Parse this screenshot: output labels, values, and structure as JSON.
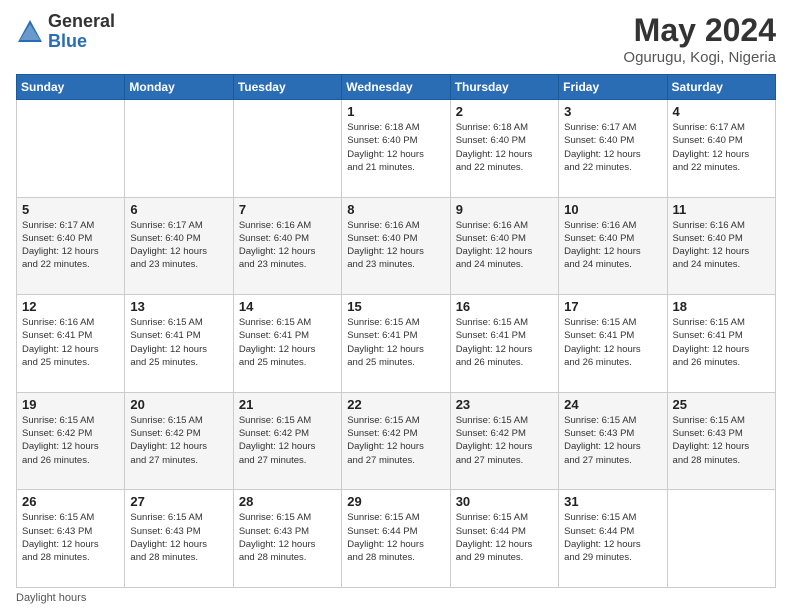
{
  "logo": {
    "general": "General",
    "blue": "Blue"
  },
  "title": "May 2024",
  "subtitle": "Ogurugu, Kogi, Nigeria",
  "days_header": [
    "Sunday",
    "Monday",
    "Tuesday",
    "Wednesday",
    "Thursday",
    "Friday",
    "Saturday"
  ],
  "weeks": [
    [
      {
        "num": "",
        "info": ""
      },
      {
        "num": "",
        "info": ""
      },
      {
        "num": "",
        "info": ""
      },
      {
        "num": "1",
        "info": "Sunrise: 6:18 AM\nSunset: 6:40 PM\nDaylight: 12 hours\nand 21 minutes."
      },
      {
        "num": "2",
        "info": "Sunrise: 6:18 AM\nSunset: 6:40 PM\nDaylight: 12 hours\nand 22 minutes."
      },
      {
        "num": "3",
        "info": "Sunrise: 6:17 AM\nSunset: 6:40 PM\nDaylight: 12 hours\nand 22 minutes."
      },
      {
        "num": "4",
        "info": "Sunrise: 6:17 AM\nSunset: 6:40 PM\nDaylight: 12 hours\nand 22 minutes."
      }
    ],
    [
      {
        "num": "5",
        "info": "Sunrise: 6:17 AM\nSunset: 6:40 PM\nDaylight: 12 hours\nand 22 minutes."
      },
      {
        "num": "6",
        "info": "Sunrise: 6:17 AM\nSunset: 6:40 PM\nDaylight: 12 hours\nand 23 minutes."
      },
      {
        "num": "7",
        "info": "Sunrise: 6:16 AM\nSunset: 6:40 PM\nDaylight: 12 hours\nand 23 minutes."
      },
      {
        "num": "8",
        "info": "Sunrise: 6:16 AM\nSunset: 6:40 PM\nDaylight: 12 hours\nand 23 minutes."
      },
      {
        "num": "9",
        "info": "Sunrise: 6:16 AM\nSunset: 6:40 PM\nDaylight: 12 hours\nand 24 minutes."
      },
      {
        "num": "10",
        "info": "Sunrise: 6:16 AM\nSunset: 6:40 PM\nDaylight: 12 hours\nand 24 minutes."
      },
      {
        "num": "11",
        "info": "Sunrise: 6:16 AM\nSunset: 6:40 PM\nDaylight: 12 hours\nand 24 minutes."
      }
    ],
    [
      {
        "num": "12",
        "info": "Sunrise: 6:16 AM\nSunset: 6:41 PM\nDaylight: 12 hours\nand 25 minutes."
      },
      {
        "num": "13",
        "info": "Sunrise: 6:15 AM\nSunset: 6:41 PM\nDaylight: 12 hours\nand 25 minutes."
      },
      {
        "num": "14",
        "info": "Sunrise: 6:15 AM\nSunset: 6:41 PM\nDaylight: 12 hours\nand 25 minutes."
      },
      {
        "num": "15",
        "info": "Sunrise: 6:15 AM\nSunset: 6:41 PM\nDaylight: 12 hours\nand 25 minutes."
      },
      {
        "num": "16",
        "info": "Sunrise: 6:15 AM\nSunset: 6:41 PM\nDaylight: 12 hours\nand 26 minutes."
      },
      {
        "num": "17",
        "info": "Sunrise: 6:15 AM\nSunset: 6:41 PM\nDaylight: 12 hours\nand 26 minutes."
      },
      {
        "num": "18",
        "info": "Sunrise: 6:15 AM\nSunset: 6:41 PM\nDaylight: 12 hours\nand 26 minutes."
      }
    ],
    [
      {
        "num": "19",
        "info": "Sunrise: 6:15 AM\nSunset: 6:42 PM\nDaylight: 12 hours\nand 26 minutes."
      },
      {
        "num": "20",
        "info": "Sunrise: 6:15 AM\nSunset: 6:42 PM\nDaylight: 12 hours\nand 27 minutes."
      },
      {
        "num": "21",
        "info": "Sunrise: 6:15 AM\nSunset: 6:42 PM\nDaylight: 12 hours\nand 27 minutes."
      },
      {
        "num": "22",
        "info": "Sunrise: 6:15 AM\nSunset: 6:42 PM\nDaylight: 12 hours\nand 27 minutes."
      },
      {
        "num": "23",
        "info": "Sunrise: 6:15 AM\nSunset: 6:42 PM\nDaylight: 12 hours\nand 27 minutes."
      },
      {
        "num": "24",
        "info": "Sunrise: 6:15 AM\nSunset: 6:43 PM\nDaylight: 12 hours\nand 27 minutes."
      },
      {
        "num": "25",
        "info": "Sunrise: 6:15 AM\nSunset: 6:43 PM\nDaylight: 12 hours\nand 28 minutes."
      }
    ],
    [
      {
        "num": "26",
        "info": "Sunrise: 6:15 AM\nSunset: 6:43 PM\nDaylight: 12 hours\nand 28 minutes."
      },
      {
        "num": "27",
        "info": "Sunrise: 6:15 AM\nSunset: 6:43 PM\nDaylight: 12 hours\nand 28 minutes."
      },
      {
        "num": "28",
        "info": "Sunrise: 6:15 AM\nSunset: 6:43 PM\nDaylight: 12 hours\nand 28 minutes."
      },
      {
        "num": "29",
        "info": "Sunrise: 6:15 AM\nSunset: 6:44 PM\nDaylight: 12 hours\nand 28 minutes."
      },
      {
        "num": "30",
        "info": "Sunrise: 6:15 AM\nSunset: 6:44 PM\nDaylight: 12 hours\nand 29 minutes."
      },
      {
        "num": "31",
        "info": "Sunrise: 6:15 AM\nSunset: 6:44 PM\nDaylight: 12 hours\nand 29 minutes."
      },
      {
        "num": "",
        "info": ""
      }
    ]
  ],
  "footer": "Daylight hours"
}
